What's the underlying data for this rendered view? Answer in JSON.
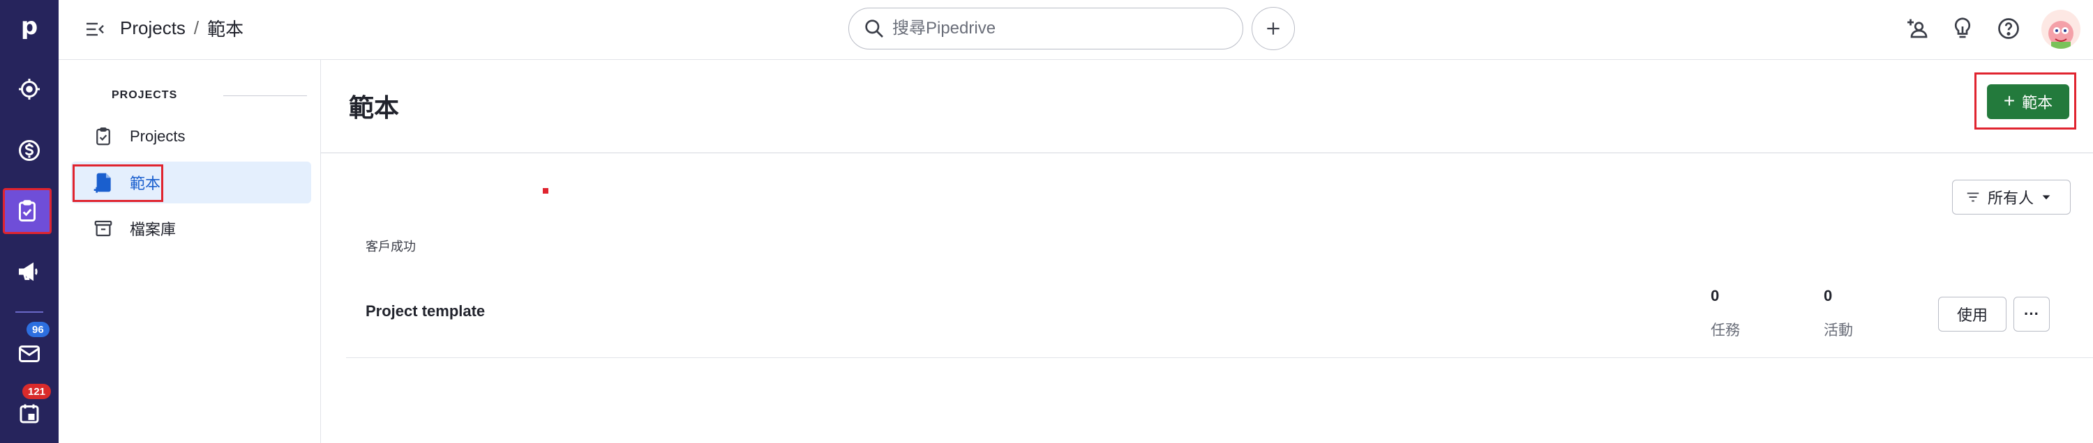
{
  "app": {
    "logo": "p"
  },
  "rail": {
    "items": [
      {
        "name": "target-icon"
      },
      {
        "name": "dollar-icon"
      },
      {
        "name": "clipboard-check-icon",
        "active": true
      },
      {
        "name": "megaphone-icon"
      },
      {
        "name": "mail-icon",
        "badge": "96"
      },
      {
        "name": "calendar-icon",
        "badge": "121"
      }
    ]
  },
  "header": {
    "breadcrumb": {
      "parent": "Projects",
      "separator": "/",
      "current": "範本"
    },
    "search": {
      "placeholder": "搜尋Pipedrive",
      "value": ""
    },
    "icons": [
      "add-user-icon",
      "lightbulb-icon",
      "help-icon"
    ]
  },
  "sidebar": {
    "section": "PROJECTS",
    "items": [
      {
        "label": "Projects",
        "icon": "clipboard-icon"
      },
      {
        "label": "範本",
        "icon": "template-icon",
        "active": true
      },
      {
        "label": "檔案庫",
        "icon": "archive-icon"
      }
    ]
  },
  "main": {
    "title": "範本",
    "add_button": "範本",
    "filter": "所有人",
    "group_label": "客戶成功",
    "templates": [
      {
        "name": "Project template",
        "tasks": "0",
        "tasks_label": "任務",
        "activities": "0",
        "activities_label": "活動",
        "use_label": "使用",
        "more_label": "···"
      }
    ]
  },
  "colors": {
    "rail": "#26245c",
    "accent": "#6f4ed8",
    "primary": "#237a3c",
    "highlight": "#e0242f",
    "active_bg": "#e4effd"
  }
}
